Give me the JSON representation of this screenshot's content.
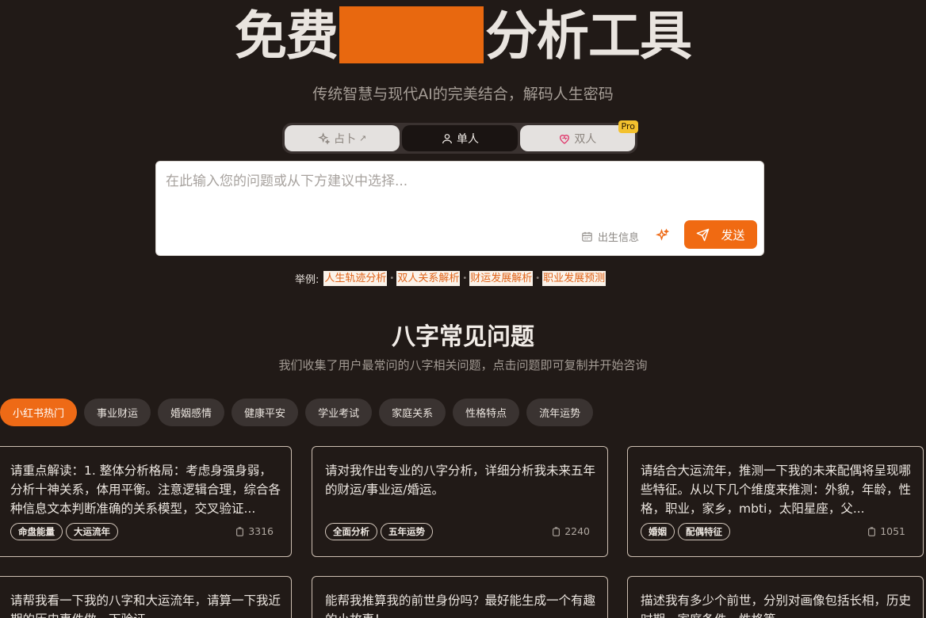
{
  "hero": {
    "title_left": "免费",
    "title_right": "分析工具",
    "subtitle": "传统智慧与现代AI的完美结合，解码人生密码"
  },
  "mode_tabs": [
    {
      "label": "占卜",
      "suffix": "↗",
      "icon": "sparkle-icon"
    },
    {
      "label": "单人",
      "icon": "user-icon",
      "active": true
    },
    {
      "label": "双人",
      "icon": "heart-icon",
      "badge": "Pro"
    }
  ],
  "query": {
    "placeholder": "在此输入您的问题或从下方建议中选择...",
    "birth_info_label": "出生信息",
    "send_label": "发送"
  },
  "examples": {
    "prefix": "举例:",
    "items": [
      "人生轨迹分析",
      "双人关系解析",
      "财运发展解析",
      "职业发展预测"
    ],
    "separator": "•"
  },
  "faq": {
    "title": "八字常见问题",
    "subtitle": "我们收集了用户最常问的八字相关问题，点击问题即可复制并开始咨询",
    "categories": [
      "小红书热门",
      "事业财运",
      "婚姻感情",
      "健康平安",
      "学业考试",
      "家庭关系",
      "性格特点",
      "流年运势"
    ],
    "active_category": 0,
    "cards": [
      {
        "text": "请重点解读：1. 整体分析格局：考虑身强身弱，分析十神关系，体用平衡。注意逻辑合理，综合各种信息文本判断准确的关系模型，交叉验证...",
        "tags": [
          "命盘能量",
          "大运流年"
        ],
        "count": "3316"
      },
      {
        "text": "请对我作出专业的八字分析，详细分析我未来五年的财运/事业运/婚运。",
        "tags": [
          "全面分析",
          "五年运势"
        ],
        "count": "2240"
      },
      {
        "text": "请结合大运流年，推测一下我的未来配偶将呈现哪些特征。从以下几个维度来推测：外貌，年龄，性格，职业，家乡，mbti，太阳星座，父...",
        "tags": [
          "婚姻",
          "配偶特征"
        ],
        "count": "1051"
      },
      {
        "text": "请帮我看一下我的八字和大运流年，请算一下我近期的历史事件做一下验证",
        "tags": [],
        "count": ""
      },
      {
        "text": "能帮我推算我的前世身份吗？最好能生成一个有趣的小故事！",
        "tags": [],
        "count": ""
      },
      {
        "text": "描述我有多少个前世，分别对画像包括长相，历史时期，家庭条件，性格等",
        "tags": [],
        "count": ""
      }
    ]
  },
  "colors": {
    "accent": "#ee6a16",
    "background": "#211a17",
    "pro_badge": "#f3c12e"
  }
}
